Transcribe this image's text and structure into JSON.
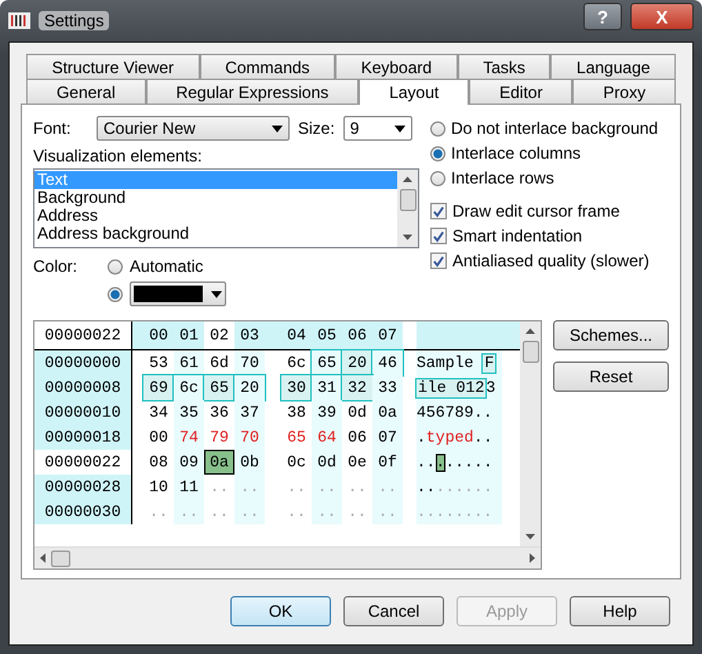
{
  "window": {
    "title": "Settings",
    "help_button": "?",
    "close_button": "X"
  },
  "tabs": [
    [
      {
        "label": "Structure Viewer",
        "selected": false
      },
      {
        "label": "Commands",
        "selected": false
      },
      {
        "label": "Keyboard",
        "selected": false
      },
      {
        "label": "Tasks",
        "selected": false
      },
      {
        "label": "Language",
        "selected": false
      }
    ],
    [
      {
        "label": "General",
        "selected": false
      },
      {
        "label": "Regular Expressions",
        "selected": false
      },
      {
        "label": "Layout",
        "selected": true
      },
      {
        "label": "Editor",
        "selected": false
      },
      {
        "label": "Proxy",
        "selected": false
      }
    ]
  ],
  "font": {
    "label": "Font:",
    "value": "Courier New"
  },
  "size": {
    "label": "Size:",
    "value": "9"
  },
  "visualization": {
    "label": "Visualization elements:",
    "items": [
      {
        "label": "Text",
        "selected": true
      },
      {
        "label": "Background",
        "selected": false
      },
      {
        "label": "Address",
        "selected": false
      },
      {
        "label": "Address background",
        "selected": false
      }
    ]
  },
  "color": {
    "label": "Color:",
    "options": [
      {
        "label": "Automatic",
        "selected": false,
        "kind": "text"
      },
      {
        "selected": true,
        "kind": "swatch",
        "color": "#000000"
      }
    ]
  },
  "interlace": [
    {
      "label": "Do not interlace background",
      "selected": false
    },
    {
      "label": "Interlace columns",
      "selected": true
    },
    {
      "label": "Interlace rows",
      "selected": false
    }
  ],
  "checkboxes": [
    {
      "label": "Draw edit cursor frame",
      "checked": true
    },
    {
      "label": "Smart indentation",
      "checked": true
    },
    {
      "label": "Antialiased quality (slower)",
      "checked": true
    }
  ],
  "hex_view": {
    "header_address": "00000022",
    "header_bytes": [
      "00",
      "01",
      "02",
      "03",
      "04",
      "05",
      "06",
      "07"
    ],
    "rows": [
      {
        "address": "00000000",
        "current": false,
        "bytes": [
          {
            "text": "53",
            "kind": "normal"
          },
          {
            "text": "61",
            "kind": "normal"
          },
          {
            "text": "6d",
            "kind": "normal"
          },
          {
            "text": "70",
            "kind": "normal"
          },
          {
            "text": "6c",
            "kind": "normal"
          },
          {
            "text": "65",
            "kind": "selected"
          },
          {
            "text": "20",
            "kind": "selected"
          },
          {
            "text": "46",
            "kind": "selected"
          }
        ],
        "ascii": [
          {
            "text": "Sample ",
            "kind": "normal"
          },
          {
            "text": "F",
            "kind": "selected"
          }
        ]
      },
      {
        "address": "00000008",
        "current": false,
        "bytes": [
          {
            "text": "69",
            "kind": "selected"
          },
          {
            "text": "6c",
            "kind": "selected"
          },
          {
            "text": "65",
            "kind": "selected"
          },
          {
            "text": "20",
            "kind": "selected"
          },
          {
            "text": "30",
            "kind": "selected"
          },
          {
            "text": "31",
            "kind": "selected"
          },
          {
            "text": "32",
            "kind": "selected"
          },
          {
            "text": "33",
            "kind": "normal"
          }
        ],
        "ascii": [
          {
            "text": "ile 012",
            "kind": "selected"
          },
          {
            "text": "3",
            "kind": "normal"
          }
        ]
      },
      {
        "address": "00000010",
        "current": false,
        "bytes": [
          {
            "text": "34",
            "kind": "normal"
          },
          {
            "text": "35",
            "kind": "normal"
          },
          {
            "text": "36",
            "kind": "normal"
          },
          {
            "text": "37",
            "kind": "normal"
          },
          {
            "text": "38",
            "kind": "normal"
          },
          {
            "text": "39",
            "kind": "normal"
          },
          {
            "text": "0d",
            "kind": "normal"
          },
          {
            "text": "0a",
            "kind": "normal"
          }
        ],
        "ascii": [
          {
            "text": "456789..",
            "kind": "normal"
          }
        ]
      },
      {
        "address": "00000018",
        "current": false,
        "bytes": [
          {
            "text": "00",
            "kind": "normal"
          },
          {
            "text": "74",
            "kind": "typed"
          },
          {
            "text": "79",
            "kind": "typed"
          },
          {
            "text": "70",
            "kind": "typed"
          },
          {
            "text": "65",
            "kind": "typed"
          },
          {
            "text": "64",
            "kind": "typed"
          },
          {
            "text": "06",
            "kind": "normal"
          },
          {
            "text": "07",
            "kind": "normal"
          }
        ],
        "ascii": [
          {
            "text": ".",
            "kind": "normal"
          },
          {
            "text": "typed",
            "kind": "typed"
          },
          {
            "text": "..",
            "kind": "normal"
          }
        ]
      },
      {
        "address": "00000022",
        "current": true,
        "bytes": [
          {
            "text": "08",
            "kind": "normal"
          },
          {
            "text": "09",
            "kind": "normal"
          },
          {
            "text": "0a",
            "kind": "cursor"
          },
          {
            "text": "0b",
            "kind": "normal"
          },
          {
            "text": "0c",
            "kind": "normal"
          },
          {
            "text": "0d",
            "kind": "normal"
          },
          {
            "text": "0e",
            "kind": "normal"
          },
          {
            "text": "0f",
            "kind": "normal"
          }
        ],
        "ascii": [
          {
            "text": "..",
            "kind": "normal"
          },
          {
            "text": ".",
            "kind": "cursor"
          },
          {
            "text": ".....",
            "kind": "normal"
          }
        ]
      },
      {
        "address": "00000028",
        "current": false,
        "bytes": [
          {
            "text": "10",
            "kind": "normal"
          },
          {
            "text": "11",
            "kind": "normal"
          },
          {
            "text": "..",
            "kind": "empty"
          },
          {
            "text": "..",
            "kind": "empty"
          },
          {
            "text": "..",
            "kind": "empty"
          },
          {
            "text": "..",
            "kind": "empty"
          },
          {
            "text": "..",
            "kind": "empty"
          },
          {
            "text": "..",
            "kind": "empty"
          }
        ],
        "ascii": [
          {
            "text": "..",
            "kind": "normal"
          },
          {
            "text": "......",
            "kind": "empty"
          }
        ]
      },
      {
        "address": "00000030",
        "current": false,
        "bytes": [
          {
            "text": "..",
            "kind": "empty"
          },
          {
            "text": "..",
            "kind": "empty"
          },
          {
            "text": "..",
            "kind": "empty"
          },
          {
            "text": "..",
            "kind": "empty"
          },
          {
            "text": "..",
            "kind": "empty"
          },
          {
            "text": "..",
            "kind": "empty"
          },
          {
            "text": "..",
            "kind": "empty"
          },
          {
            "text": "..",
            "kind": "empty"
          }
        ],
        "ascii": [
          {
            "text": "........",
            "kind": "empty"
          }
        ]
      }
    ]
  },
  "side_buttons": [
    "Schemes...",
    "Reset"
  ],
  "buttons": [
    {
      "label": "OK",
      "disabled": false,
      "default": true
    },
    {
      "label": "Cancel",
      "disabled": false,
      "default": false
    },
    {
      "label": "Apply",
      "disabled": true,
      "default": false
    },
    {
      "label": "Help",
      "disabled": false,
      "default": false
    }
  ]
}
